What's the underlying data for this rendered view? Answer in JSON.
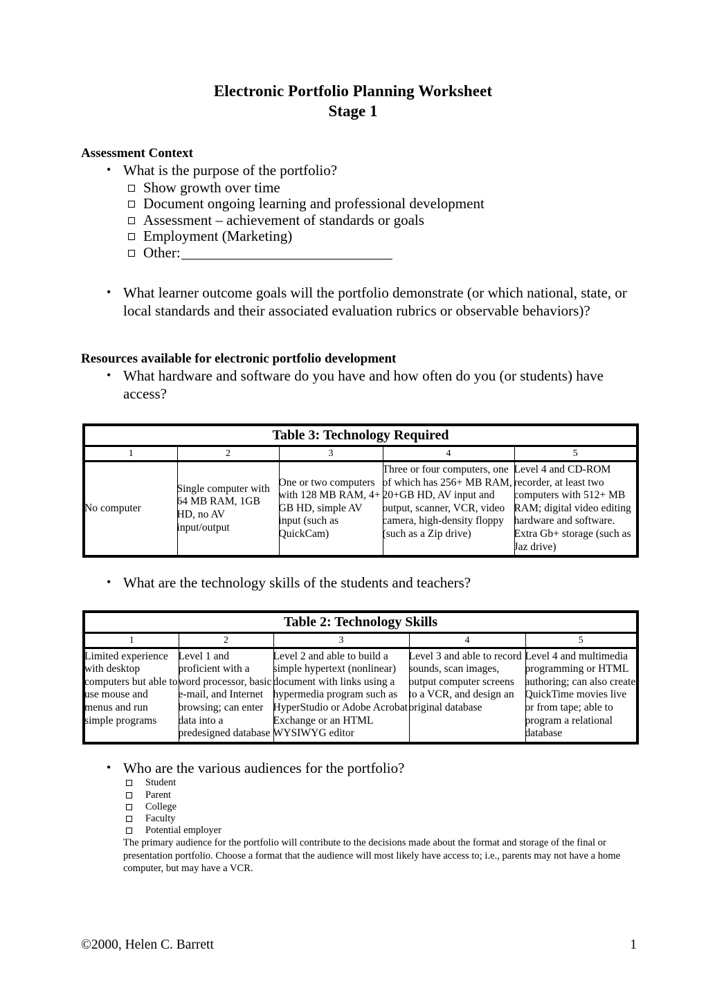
{
  "document": {
    "title": "Electronic Portfolio Planning Worksheet",
    "subtitle": "Stage 1"
  },
  "assessment_context": {
    "heading": "Assessment Context",
    "question_purpose": "What is the purpose of the portfolio?",
    "purpose_options": [
      "Show growth over time",
      "Document ongoing learning and professional development",
      "Assessment – achievement of standards or goals",
      "Employment (Marketing)"
    ],
    "other_label": "Other:",
    "question_outcomes": "What learner outcome goals will the portfolio demonstrate (or which national, state, or local standards and their associated evaluation rubrics or observable behaviors)?"
  },
  "resources": {
    "heading": "Resources available for electronic portfolio development",
    "question_hardware": "What hardware and software do you have and how often do you (or students) have access?",
    "question_skills": "What are the technology skills of the students and teachers?",
    "question_audiences": "Who are the various audiences for the portfolio?",
    "audience_options": [
      "Student",
      "Parent",
      "College",
      "Faculty",
      "Potential employer"
    ],
    "audience_note": "The primary audience for the portfolio will contribute to the decisions made about the format and storage of the final or presentation portfolio. Choose a format that the audience will most likely have access to; i.e., parents may not have a home computer, but may have a VCR."
  },
  "table3": {
    "caption": "Table 3: Technology Required",
    "levels": [
      "1",
      "2",
      "3",
      "4",
      "5"
    ],
    "cells": [
      "No computer",
      "Single computer with 64 MB RAM, 1GB HD, no AV input/output",
      "One or two computers with 128 MB RAM, 4+ GB HD, simple AV input (such as QuickCam)",
      "Three or four computers, one of which has 256+ MB RAM, 20+GB HD, AV input and output, scanner, VCR, video camera, high-density floppy (such as a Zip drive)",
      "Level 4 and CD-ROM recorder, at least two computers with 512+ MB RAM; digital video editing hardware and software. Extra Gb+ storage (such as Jaz drive)"
    ]
  },
  "table2": {
    "caption": "Table 2: Technology Skills",
    "levels": [
      "1",
      "2",
      "3",
      "4",
      "5"
    ],
    "cells": [
      "Limited experience with desktop computers but able to use mouse and menus and run simple programs",
      "Level 1 and proficient with a word processor, basic e-mail, and Internet browsing; can enter data into a predesigned database",
      "Level 2 and able to build a simple hypertext (nonlinear) document with links using a hypermedia program such as HyperStudio or Adobe Acrobat Exchange or an HTML WYSIWYG editor",
      "Level 3 and able to record sounds, scan images, output computer screens to a VCR, and design an original database",
      "Level 4 and multimedia programming or HTML authoring; can also create QuickTime movies live or from tape; able to program a relational database"
    ]
  },
  "footer": {
    "copyright": "©2000, Helen C. Barrett",
    "page_number": "1"
  }
}
